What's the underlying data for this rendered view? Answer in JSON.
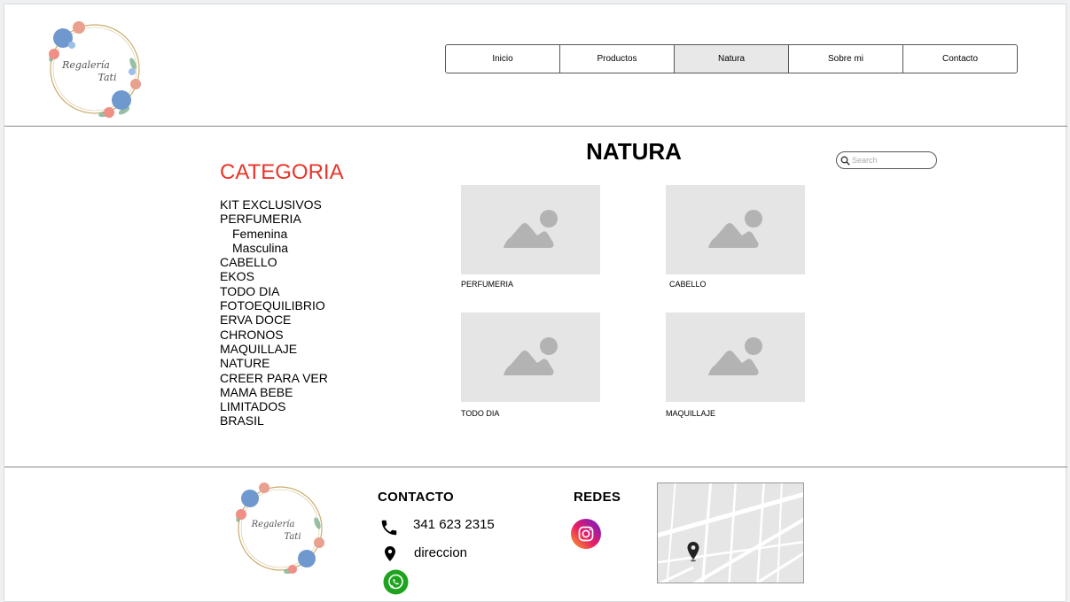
{
  "brand": {
    "logo_text_line1": "Regalería",
    "logo_text_line2": "Tati"
  },
  "nav": {
    "items": [
      {
        "label": "Inicio",
        "active": false
      },
      {
        "label": "Productos",
        "active": false
      },
      {
        "label": "Natura",
        "active": true
      },
      {
        "label": "Sobre mi",
        "active": false
      },
      {
        "label": "Contacto",
        "active": false
      }
    ]
  },
  "sidebar": {
    "title": "CATEGORIA",
    "title_color": "#e8352a",
    "items": [
      {
        "label": "KIT EXCLUSIVOS",
        "sub": false
      },
      {
        "label": "PERFUMERIA",
        "sub": false
      },
      {
        "label": "Femenina",
        "sub": true
      },
      {
        "label": "Masculina",
        "sub": true
      },
      {
        "label": "CABELLO",
        "sub": false
      },
      {
        "label": "EKOS",
        "sub": false
      },
      {
        "label": "TODO DIA",
        "sub": false
      },
      {
        "label": "FOTOEQUILIBRIO",
        "sub": false
      },
      {
        "label": "ERVA DOCE",
        "sub": false
      },
      {
        "label": "CHRONOS",
        "sub": false
      },
      {
        "label": "MAQUILLAJE",
        "sub": false
      },
      {
        "label": "NATURE",
        "sub": false
      },
      {
        "label": "CREER PARA VER",
        "sub": false
      },
      {
        "label": "MAMA BEBE",
        "sub": false
      },
      {
        "label": "LIMITADOS",
        "sub": false
      },
      {
        "label": "BRASIL",
        "sub": false
      }
    ]
  },
  "main": {
    "title": "NATURA",
    "search": {
      "placeholder": "Search",
      "value": ""
    },
    "cards": [
      {
        "label": "PERFUMERIA",
        "icon": "image-placeholder-icon"
      },
      {
        "label": "CABELLO",
        "icon": "image-placeholder-icon"
      },
      {
        "label": "TODO DIA",
        "icon": "image-placeholder-icon"
      },
      {
        "label": "MAQUILLAJE",
        "icon": "image-placeholder-icon"
      }
    ]
  },
  "footer": {
    "contact_heading": "CONTACTO",
    "phone": "341 623 2315",
    "address": "direccion",
    "social_heading": "REDES",
    "icons": {
      "phone": "phone-icon",
      "location": "location-pin-icon",
      "whatsapp": "whatsapp-icon",
      "instagram": "instagram-icon"
    },
    "whatsapp_color": "#1fa31f"
  },
  "colors": {
    "placeholder_bg": "#e5e5e5",
    "placeholder_shape": "#b3b3b3",
    "divider": "#888888"
  }
}
